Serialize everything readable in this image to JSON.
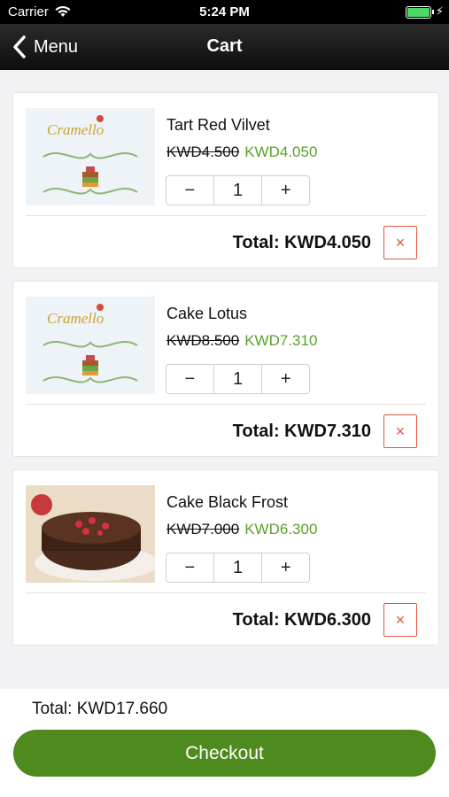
{
  "status_bar": {
    "carrier": "Carrier",
    "time": "5:24 PM"
  },
  "nav": {
    "back_label": "Menu",
    "title": "Cart"
  },
  "items": [
    {
      "name": "Tart Red Vilvet",
      "old_price": "KWD4.500",
      "new_price": "KWD4.050",
      "quantity": "1",
      "total": "Total: KWD4.050",
      "minus": "−",
      "plus": "+",
      "remove": "×",
      "image": "cramello-logo"
    },
    {
      "name": "Cake Lotus",
      "old_price": "KWD8.500",
      "new_price": "KWD7.310",
      "quantity": "1",
      "total": "Total: KWD7.310",
      "minus": "−",
      "plus": "+",
      "remove": "×",
      "image": "cramello-logo"
    },
    {
      "name": "Cake Black Frost",
      "old_price": "KWD7.000",
      "new_price": "KWD6.300",
      "quantity": "1",
      "total": "Total: KWD6.300",
      "minus": "−",
      "plus": "+",
      "remove": "×",
      "image": "chocolate-cake-photo"
    }
  ],
  "footer": {
    "grand_total": "Total: KWD17.660",
    "checkout_label": "Checkout"
  },
  "colors": {
    "discount": "#5aa02c",
    "remove": "#e0573d",
    "checkout": "#4e8a1e"
  }
}
